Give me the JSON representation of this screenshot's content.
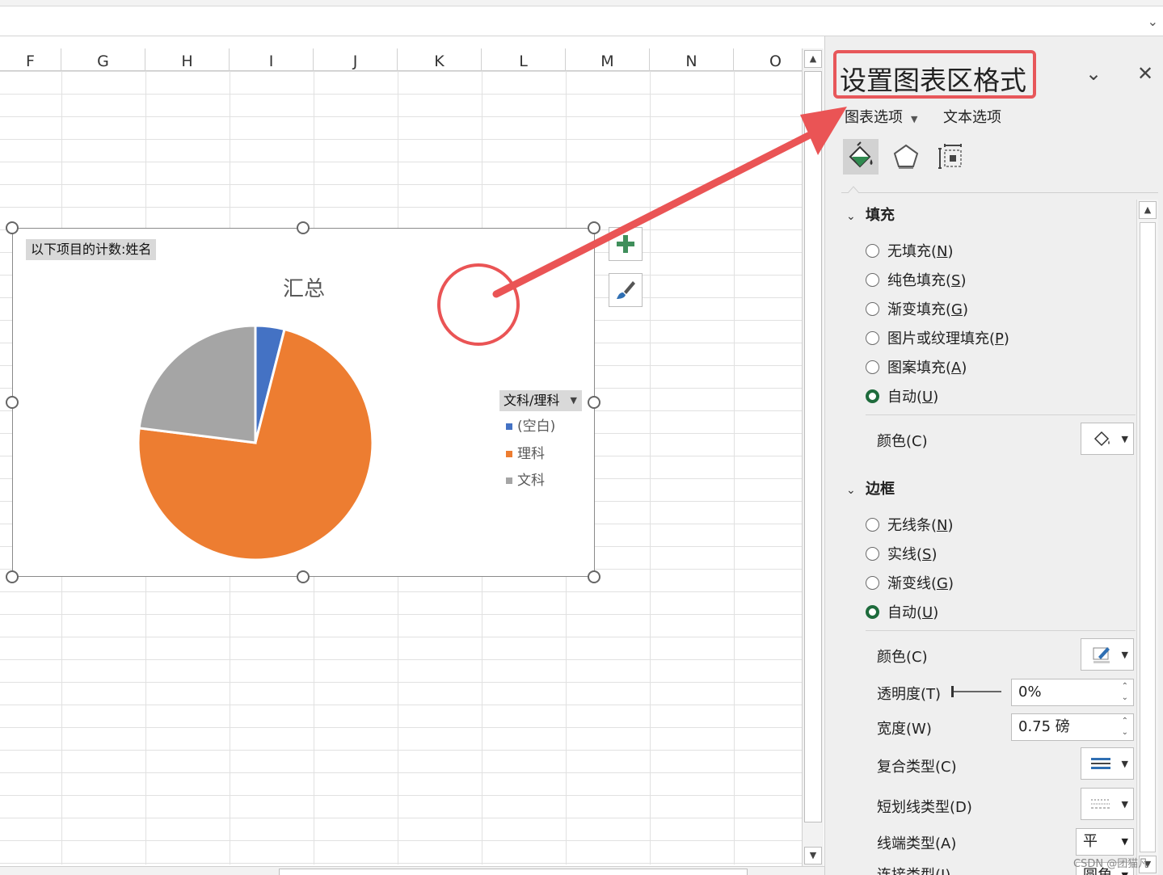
{
  "sheet": {
    "columns": [
      "F",
      "G",
      "H",
      "I",
      "J",
      "K",
      "L",
      "M",
      "N",
      "O"
    ]
  },
  "chart": {
    "pivot_field_button": "以下项目的计数:姓名",
    "title": "汇总",
    "legend_filter_label": "文科/理科",
    "legend": [
      {
        "name": "(空白)",
        "color": "#4472c4"
      },
      {
        "name": "理科",
        "color": "#ed7d31"
      },
      {
        "name": "文科",
        "color": "#a5a5a5"
      }
    ],
    "add_element_icon": "plus-icon",
    "style_icon": "paintbrush-icon"
  },
  "chart_data": {
    "type": "pie",
    "title": "汇总",
    "categories": [
      "(空白)",
      "理科",
      "文科"
    ],
    "values": [
      4,
      73,
      23
    ],
    "colors": [
      "#4472c4",
      "#ed7d31",
      "#a5a5a5"
    ],
    "legend_position": "right"
  },
  "pane": {
    "title": "设置图表区格式",
    "tab_chart_options": "图表选项",
    "tab_text_options": "文本选项",
    "fill": {
      "heading": "填充",
      "options": [
        {
          "label": "无填充(",
          "key": "N",
          "selected": false
        },
        {
          "label": "纯色填充(",
          "key": "S",
          "selected": false
        },
        {
          "label": "渐变填充(",
          "key": "G",
          "selected": false
        },
        {
          "label": "图片或纹理填充(",
          "key": "P",
          "selected": false
        },
        {
          "label": "图案填充(",
          "key": "A",
          "selected": false
        },
        {
          "label": "自动(",
          "key": "U",
          "selected": true
        }
      ],
      "color_label": "颜色(C)"
    },
    "border": {
      "heading": "边框",
      "options": [
        {
          "label": "无线条(",
          "key": "N",
          "selected": false
        },
        {
          "label": "实线(",
          "key": "S",
          "selected": false
        },
        {
          "label": "渐变线(",
          "key": "G",
          "selected": false
        },
        {
          "label": "自动(",
          "key": "U",
          "selected": true
        }
      ],
      "color_label": "颜色(C)",
      "transparency_label": "透明度(T)",
      "transparency_value": "0%",
      "width_label": "宽度(W)",
      "width_value": "0.75 磅",
      "compound_label": "复合类型(C)",
      "dash_label": "短划线类型(D)",
      "cap_label": "线端类型(A)",
      "cap_value": "平",
      "join_label": "连接类型(J)",
      "join_value": "圆角"
    }
  },
  "annotation": {
    "color": "#ea5455"
  },
  "watermark": "CSDN @团猫凡"
}
